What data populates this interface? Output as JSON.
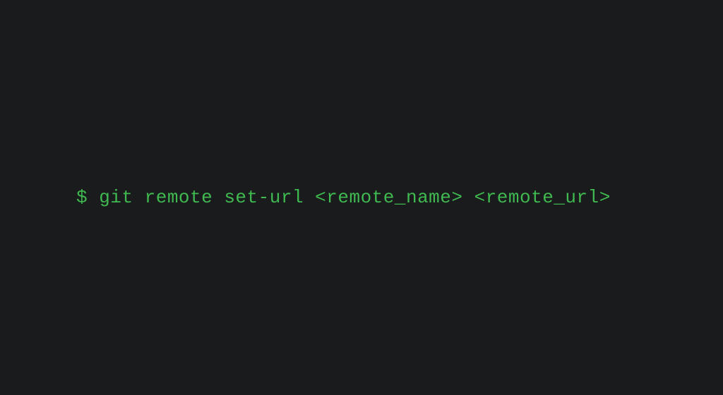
{
  "terminal": {
    "command_line": "$ git remote set-url <remote_name> <remote_url>",
    "colors": {
      "background": "#1a1b1d",
      "text": "#3fb950"
    }
  }
}
